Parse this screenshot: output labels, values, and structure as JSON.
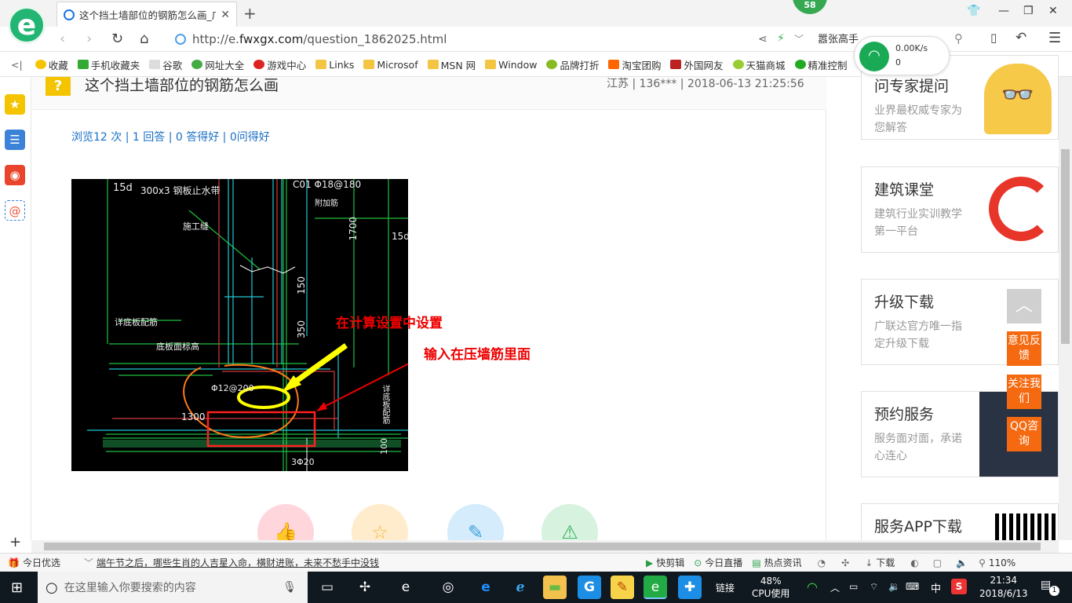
{
  "browser": {
    "tab_title": "这个挡土墙部位的钢筋怎么画_广",
    "badge_count": "58",
    "url_prefix": "http://e.",
    "url_domain": "fwxgx.com",
    "url_path": "/question_1862025.html",
    "search_text": "嚣张高手",
    "network": {
      "speed": "0.00K/s",
      "count": "0"
    }
  },
  "bookmarks": [
    "收藏",
    "手机收藏夹",
    "谷歌",
    "网址大全",
    "游戏中心",
    "Links",
    "Microsof",
    "MSN 网",
    "Window",
    "品牌打折",
    "淘宝团购",
    "外国网友",
    "天猫商城",
    "精准控制"
  ],
  "question": {
    "title": "这个挡土墙部位的钢筋怎么画",
    "meta": "江苏 | 136*** | 2018-06-13 21:25:56",
    "stats": "浏览12 次 | 1 回答 | 0 答得好 | 0问得好"
  },
  "cad_annotations": {
    "note1": "在计算设置中设置",
    "note2": "输入在压墙筋里面"
  },
  "cad_labels": [
    "15d",
    "300x3 钢板止水带",
    "施工缝",
    "C01 Φ18@180",
    "附加筋",
    "1700",
    "15d",
    "150",
    "350",
    "详底板配筋",
    "底板面标高",
    "Φ12@200",
    "1300",
    "3Φ20",
    "100",
    "详底板配筋"
  ],
  "right_panels": [
    {
      "title": "问专家提问",
      "desc": "业界最权威专家为您解答"
    },
    {
      "title": "建筑课堂",
      "desc": "建筑行业实训教学第一平台"
    },
    {
      "title": "升级下载",
      "desc": "广联达官方唯一指定升级下载"
    },
    {
      "title": "预约服务",
      "desc": "服务面对面，承诺心连心"
    },
    {
      "title": "服务APP下载",
      "desc": ""
    }
  ],
  "float_buttons": [
    "意见反馈",
    "关注我们",
    "QQ咨询"
  ],
  "statusbar": {
    "news": "今日优选",
    "headline": "端午节之后，哪些生肖的人吉星入命，横财进账，未来不愁手中没钱",
    "items": [
      "快剪辑",
      "今日直播",
      "热点资讯",
      "下载"
    ],
    "zoom": "110%"
  },
  "taskbar": {
    "search_placeholder": "在这里输入你要搜索的内容",
    "link_label": "链接",
    "cpu_percent": "48%",
    "cpu_label": "CPU使用",
    "ime": "中",
    "time": "21:34",
    "date": "2018/6/13",
    "notifications": "1"
  },
  "colors": {
    "accent_blue": "#1a6fc4",
    "cad_red": "#e00000",
    "cad_yellow": "#ffff00",
    "float_orange": "#f56a10"
  }
}
